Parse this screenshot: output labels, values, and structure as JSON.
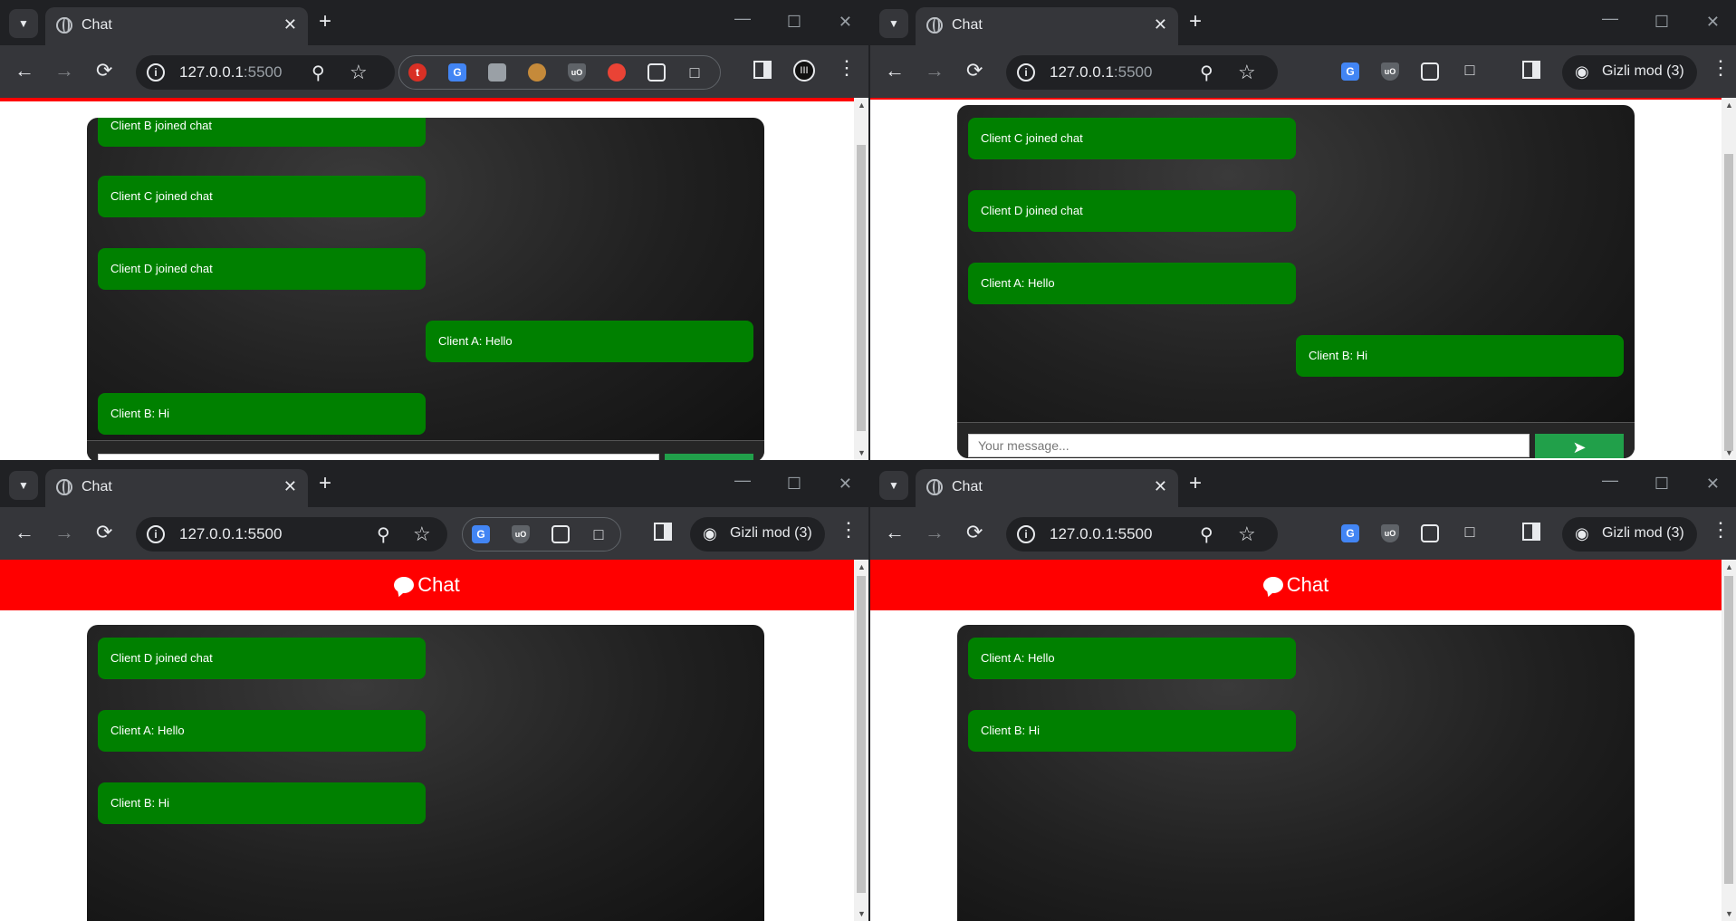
{
  "browser": {
    "tab_title": "Chat",
    "url_host": "127.0.0.1",
    "url_port": ":5500",
    "incognito_label": "Gizli mod (3)"
  },
  "page": {
    "header_title": "Chat",
    "input_placeholder": "Your message...",
    "accent_color": "#ff0000",
    "bubble_color": "#008000",
    "send_color": "#21a04a"
  },
  "windows": [
    {
      "messages": [
        {
          "text": "Client B joined chat",
          "side": "left"
        },
        {
          "text": "Client C joined chat",
          "side": "left"
        },
        {
          "text": "Client D joined chat",
          "side": "left"
        },
        {
          "text": "Client A: Hello",
          "side": "right"
        },
        {
          "text": "Client B: Hi",
          "side": "left"
        }
      ]
    },
    {
      "messages": [
        {
          "text": "Client C joined chat",
          "side": "left"
        },
        {
          "text": "Client D joined chat",
          "side": "left"
        },
        {
          "text": "Client A: Hello",
          "side": "left"
        },
        {
          "text": "Client B: Hi",
          "side": "right"
        }
      ]
    },
    {
      "messages": [
        {
          "text": "Client D joined chat",
          "side": "left"
        },
        {
          "text": "Client A: Hello",
          "side": "left"
        },
        {
          "text": "Client B: Hi",
          "side": "left"
        }
      ]
    },
    {
      "messages": [
        {
          "text": "Client A: Hello",
          "side": "left"
        },
        {
          "text": "Client B: Hi",
          "side": "left"
        }
      ]
    }
  ]
}
